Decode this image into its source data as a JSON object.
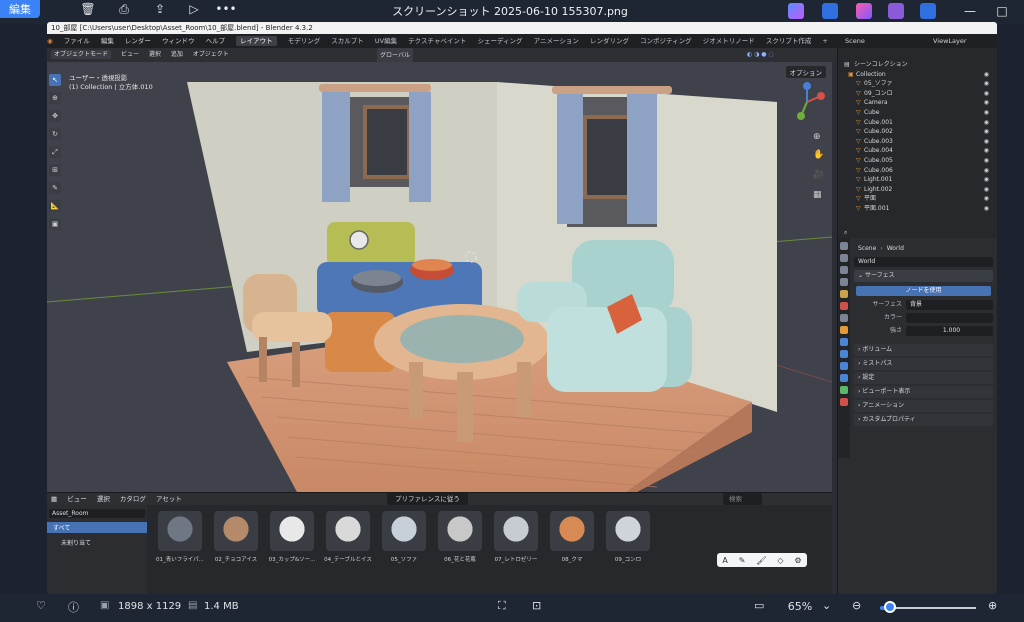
{
  "viewer": {
    "edit_label": "編集",
    "title": "スクリーンショット 2025-06-10 155307.png",
    "dimensions": "1898 x 1129",
    "file_size": "1.4 MB",
    "zoom": "65%",
    "zoom_slider_fraction": 0.1,
    "accent_color": "#3b82f6"
  },
  "blender": {
    "title_bar": "10_部屋 [C:\\Users\\user\\Desktop\\Asset_Room\\10_部屋.blend] - Blender 4.3.2",
    "menu": [
      "ファイル",
      "編集",
      "レンダー",
      "ウィンドウ",
      "ヘルプ"
    ],
    "workspaces": [
      "レイアウト",
      "モデリング",
      "スカルプト",
      "UV編集",
      "テクスチャペイント",
      "シェーディング",
      "アニメーション",
      "レンダリング",
      "コンポジティング",
      "ジオメトリノード",
      "スクリプト作成"
    ],
    "active_workspace": "レイアウト",
    "scene_label": "Scene",
    "view_layer_label": "ViewLayer",
    "viewport_header": {
      "mode": "オブジェクトモード",
      "items": [
        "ビュー",
        "選択",
        "追加",
        "オブジェクト"
      ],
      "transform": "グローバル"
    },
    "viewport_info": {
      "line1": "ユーザー・透視投影",
      "line2": "(1) Collection | 立方体.010"
    },
    "options_label": "オプション",
    "outliner": {
      "root": "シーンコレクション",
      "rows": [
        {
          "name": "Collection"
        },
        {
          "name": "05_ソファ"
        },
        {
          "name": "09_コンロ"
        },
        {
          "name": "Camera"
        },
        {
          "name": "Cube"
        },
        {
          "name": "Cube.001"
        },
        {
          "name": "Cube.002"
        },
        {
          "name": "Cube.003"
        },
        {
          "name": "Cube.004"
        },
        {
          "name": "Cube.005"
        },
        {
          "name": "Cube.006"
        },
        {
          "name": "Light.001"
        },
        {
          "name": "Light.002"
        },
        {
          "name": "平面"
        },
        {
          "name": "平面.001"
        }
      ]
    },
    "properties": {
      "breadcrumb_scene": "Scene",
      "breadcrumb_world": "World",
      "world_name": "World",
      "surface_section": "サーフェス",
      "use_nodes_button": "ノードを使用",
      "surface_label": "サーフェス",
      "surface_value": "背景",
      "color_label": "カラー",
      "strength_label": "強さ",
      "strength_value": "1.000",
      "sections": [
        "ボリューム",
        "ミストパス",
        "設定",
        "ビューポート表示",
        "アニメーション",
        "カスタムプロパティ"
      ]
    },
    "asset_browser": {
      "header_items": [
        "ビュー",
        "選択",
        "カタログ",
        "アセット"
      ],
      "library": "Asset_Room",
      "import_method": "プリファレンスに従う",
      "search_placeholder": "検索",
      "catalog_all": "すべて",
      "catalog_unassigned": "未割り当て",
      "assets": [
        "01_青いフライパ...",
        "02_チョコアイス",
        "03_カップ&ソー...",
        "04_テーブルとイス",
        "05_ソファ",
        "06_花と花瓶",
        "07_レトロゼリー",
        "08_クマ",
        "09_コンロ"
      ]
    }
  }
}
